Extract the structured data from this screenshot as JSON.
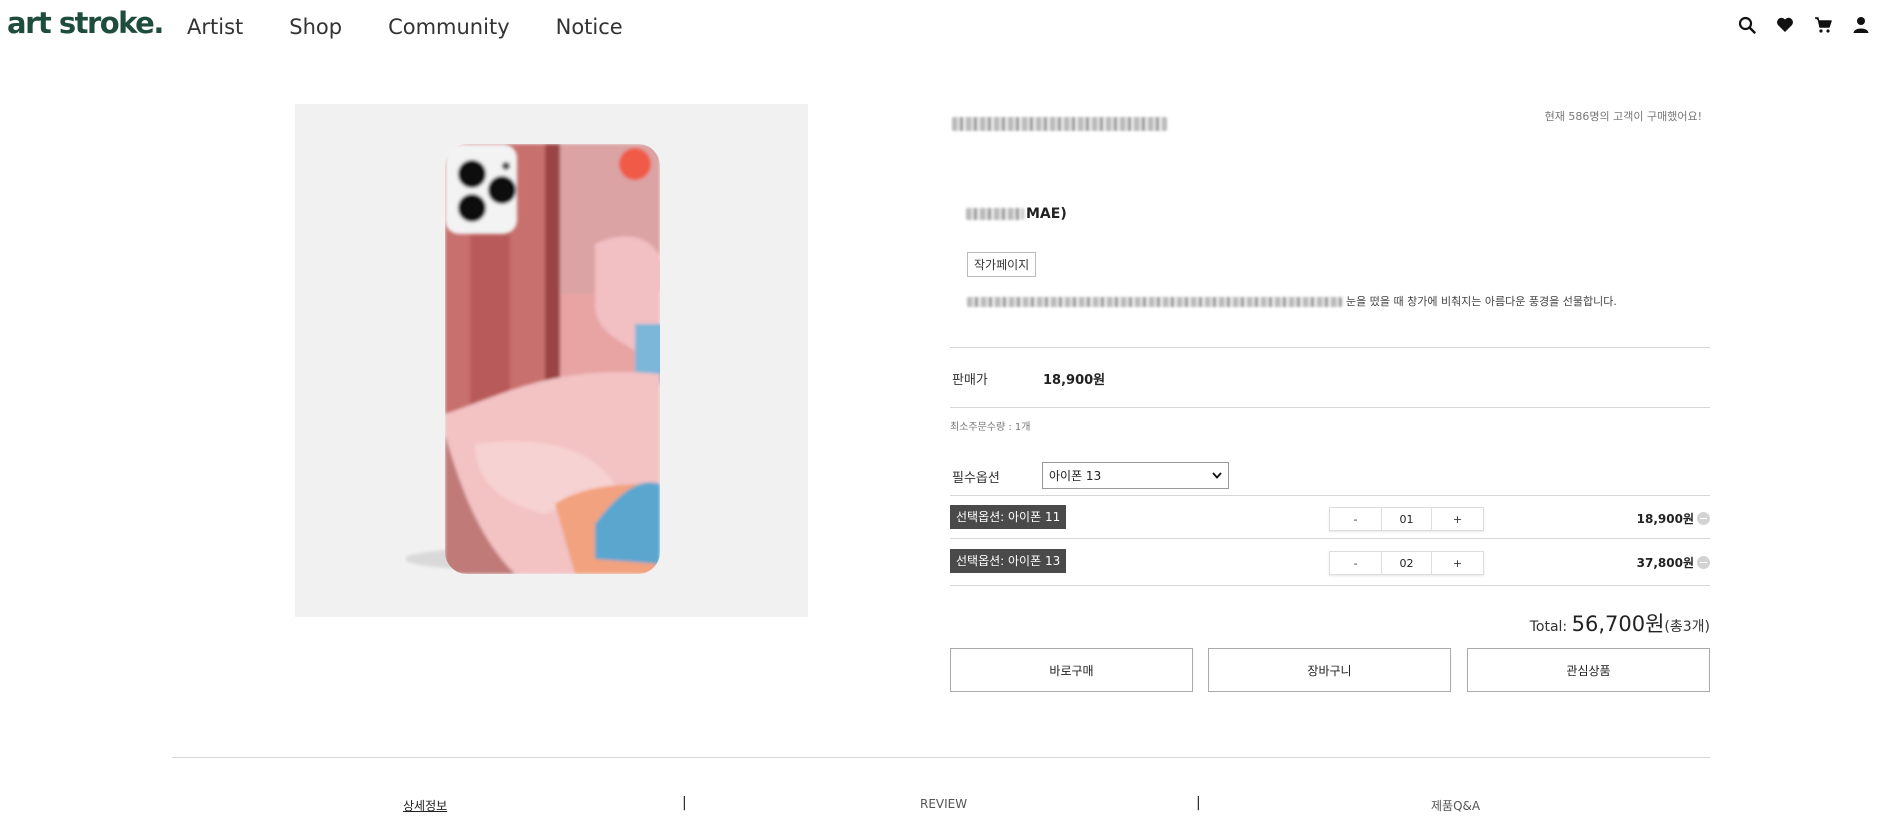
{
  "header": {
    "logo": "art stroke.",
    "nav": [
      "Artist",
      "Shop",
      "Community",
      "Notice"
    ],
    "icons": [
      "search-icon",
      "heart-icon",
      "cart-icon",
      "user-icon"
    ]
  },
  "product": {
    "buyers_text": "현재 586명의 고객이 구매했어요!",
    "artist_suffix": "MAE)",
    "artist_page_button": "작가페이지",
    "description_visible": "눈을 떴을 때 창가에 비춰지는 아름다운 풍경을 선물합니다.",
    "price_label": "판매가",
    "price_value": "18,900원",
    "min_order": "최소주문수량 : 1개",
    "option_label": "필수옵션",
    "option_selected": "아이폰 13",
    "selected_options": [
      {
        "tag": "선택옵션: 아이폰 11",
        "qty_minus": "-",
        "qty": "01",
        "qty_plus": "+",
        "price": "18,900원"
      },
      {
        "tag": "선택옵션: 아이폰 13",
        "qty_minus": "-",
        "qty": "02",
        "qty_plus": "+",
        "price": "37,800원"
      }
    ],
    "total_label": "Total:",
    "total_amount": "56,700원",
    "total_count": "(총3개)",
    "buttons": {
      "buy_now": "바로구매",
      "cart": "장바구니",
      "wishlist": "관심상품"
    }
  },
  "tabs": {
    "items": [
      "상세정보",
      "REVIEW",
      "제품Q&A"
    ],
    "separator": "|"
  },
  "colors": {
    "brand": "#1f4d3d",
    "option_tag_bg": "#4a4a4a",
    "image_bg": "#f1f1f1"
  }
}
